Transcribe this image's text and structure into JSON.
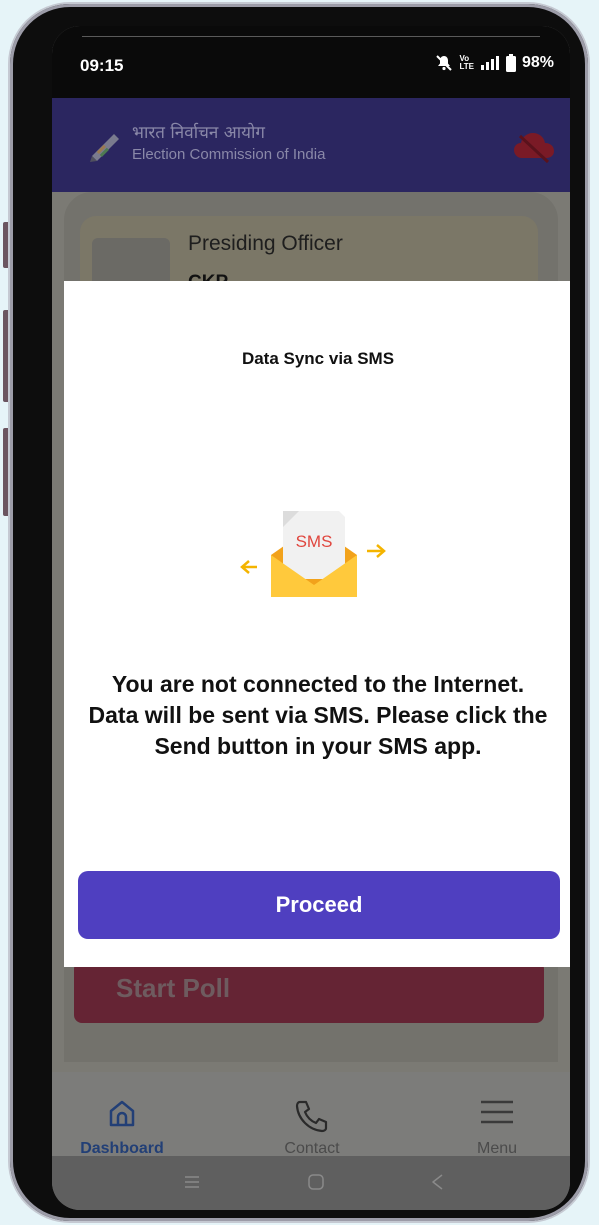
{
  "status_bar": {
    "time": "09:15",
    "battery": "98%",
    "net_top": "Vo",
    "net_bottom": "LTE"
  },
  "header": {
    "title_hindi": "भारत निर्वाचन आयोग",
    "title_english": "Election Commission of India"
  },
  "officer_card": {
    "role": "Presiding Officer",
    "name": "CKP"
  },
  "start_poll_label": "Start Poll",
  "dialog": {
    "title": "Data Sync via SMS",
    "illustration_text": "SMS",
    "message": "You are not connected to the Internet. Data will be sent via SMS. Please click the Send button in your SMS app.",
    "proceed_label": "Proceed"
  },
  "bottom_nav": {
    "items": [
      {
        "label": "Dashboard",
        "icon": "home-icon",
        "active": true
      },
      {
        "label": "Contact",
        "icon": "phone-icon",
        "active": false
      },
      {
        "label": "Menu",
        "icon": "hamburger-menu-icon",
        "active": false
      }
    ]
  },
  "colors": {
    "accent": "#4f3fc0",
    "header": "#2b2660",
    "active_nav": "#223f76",
    "start_poll": "#652434"
  }
}
